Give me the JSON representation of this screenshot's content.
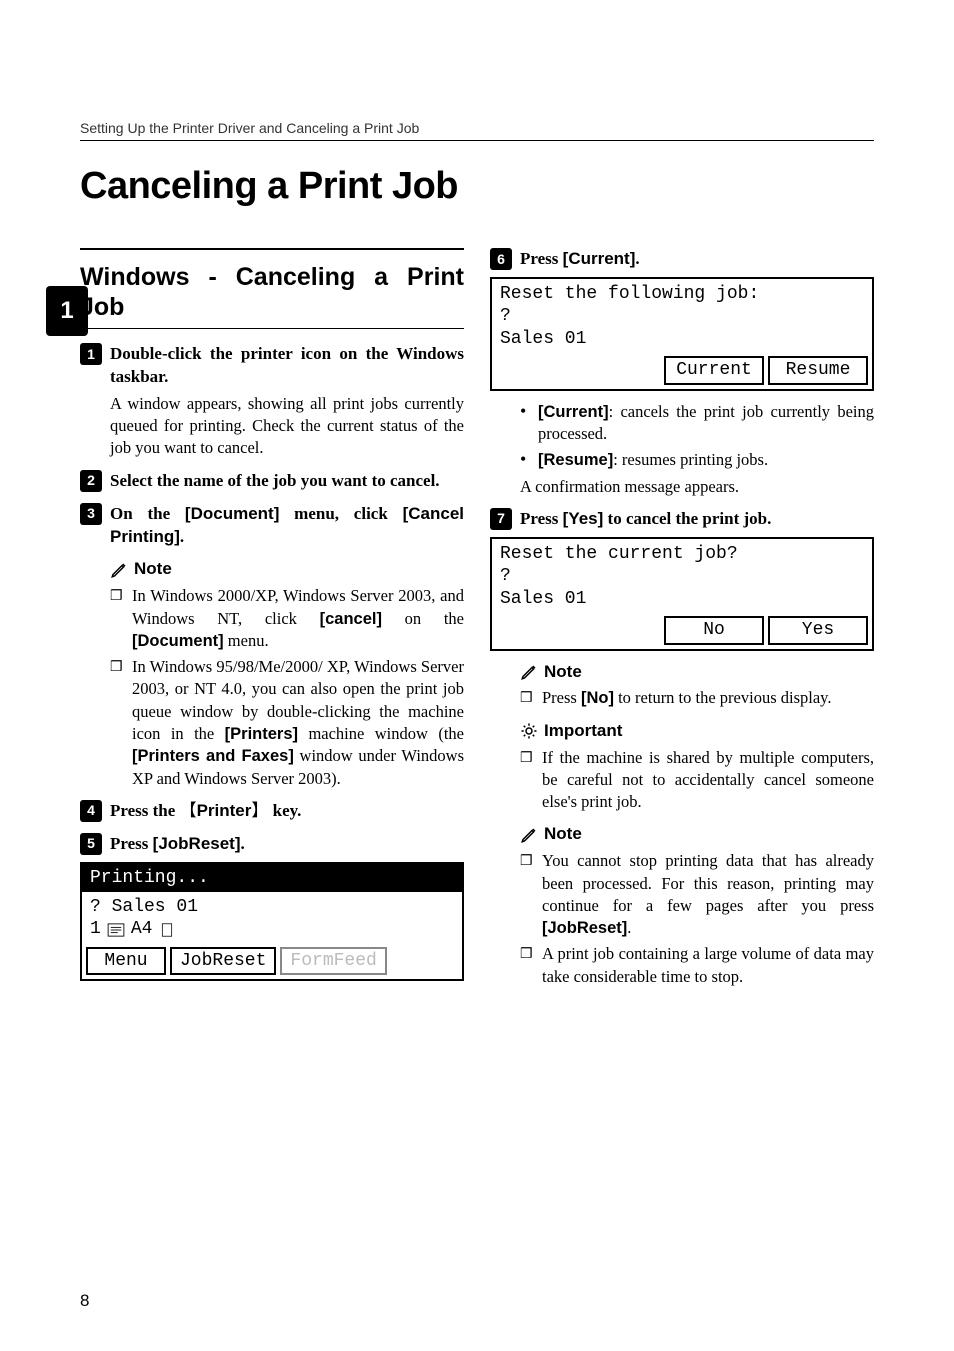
{
  "running_header": "Setting Up the Printer Driver and Canceling a Print Job",
  "title": "Canceling a Print Job",
  "side_tab": "1",
  "page_number": "8",
  "section_heading": "Windows - Canceling a Print Job",
  "labels": {
    "note": "Note",
    "important": "Important"
  },
  "steps": {
    "s1": {
      "num": "1",
      "text_pre": "Double-click the printer icon on the Windows taskbar.",
      "detail": "A window appears, showing all print jobs currently queued for printing. Check the current status of the job you want to cancel."
    },
    "s2": {
      "num": "2",
      "text": "Select the name of the job you want to cancel."
    },
    "s3": {
      "num": "3",
      "pre": "On the ",
      "ui1": "[Document]",
      "mid": " menu, click ",
      "ui2": "[Cancel Printing]",
      "post": "."
    },
    "s4": {
      "num": "4",
      "pre": "Press the ",
      "key": "Printer",
      "post": " key."
    },
    "s5": {
      "num": "5",
      "pre": "Press ",
      "ui": "[JobReset]",
      "post": "."
    },
    "s6": {
      "num": "6",
      "pre": "Press ",
      "ui": "[Current]",
      "post": "."
    },
    "s7": {
      "num": "7",
      "pre": "Press ",
      "ui": "[Yes]",
      "post": " to cancel the print job."
    }
  },
  "notes_left": {
    "n1": {
      "pre": "In Windows 2000/XP, Windows Server 2003, and Windows NT, click ",
      "ui1": "[cancel]",
      "mid": " on the ",
      "ui2": "[Document]",
      "post": " menu."
    },
    "n2": {
      "pre": "In Windows 95/98/Me/2000/ XP, Windows Server 2003, or NT 4.0, you can also open the print job queue window by double-clicking the machine icon in the ",
      "ui1": "[Printers]",
      "mid": " machine window (the ",
      "ui2": "[Printers and Faxes]",
      "post": " window under Windows XP and Windows Server 2003)."
    }
  },
  "right_bullets_after6": {
    "b1": {
      "ui": "[Current]",
      "text": ": cancels the print job currently being processed."
    },
    "b2": {
      "ui": "[Resume]",
      "text": ": resumes printing jobs."
    },
    "line": "A confirmation message appears."
  },
  "notes_right": {
    "n1": {
      "pre": "Press ",
      "ui": "[No]",
      "post": " to return to the previous display."
    }
  },
  "important_right": {
    "text": "If the machine is shared by multiple computers, be careful not to accidentally cancel someone else's print job."
  },
  "final_notes": {
    "n1": {
      "pre": "You cannot stop printing data that has already been processed. For this reason, printing may continue for a few pages after you press ",
      "ui": "[JobReset]",
      "post": "."
    },
    "n2": {
      "text": "A print job containing a large volume of data may take considerable time to stop."
    }
  },
  "lcd1": {
    "title": "Printing...",
    "line1": "? Sales 01",
    "line2_prefix": "1 ",
    "line2_paper": "A4",
    "buttons": {
      "menu": "Menu",
      "jobreset": "JobReset",
      "formfeed": "FormFeed"
    }
  },
  "lcd2": {
    "line1": "Reset the following job:",
    "line2": "?",
    "line3": "Sales 01",
    "buttons": {
      "current": "Current",
      "resume": "Resume"
    }
  },
  "lcd3": {
    "line1": "Reset the current job?",
    "line2": "?",
    "line3": "Sales 01",
    "buttons": {
      "no": "No",
      "yes": "Yes"
    }
  }
}
